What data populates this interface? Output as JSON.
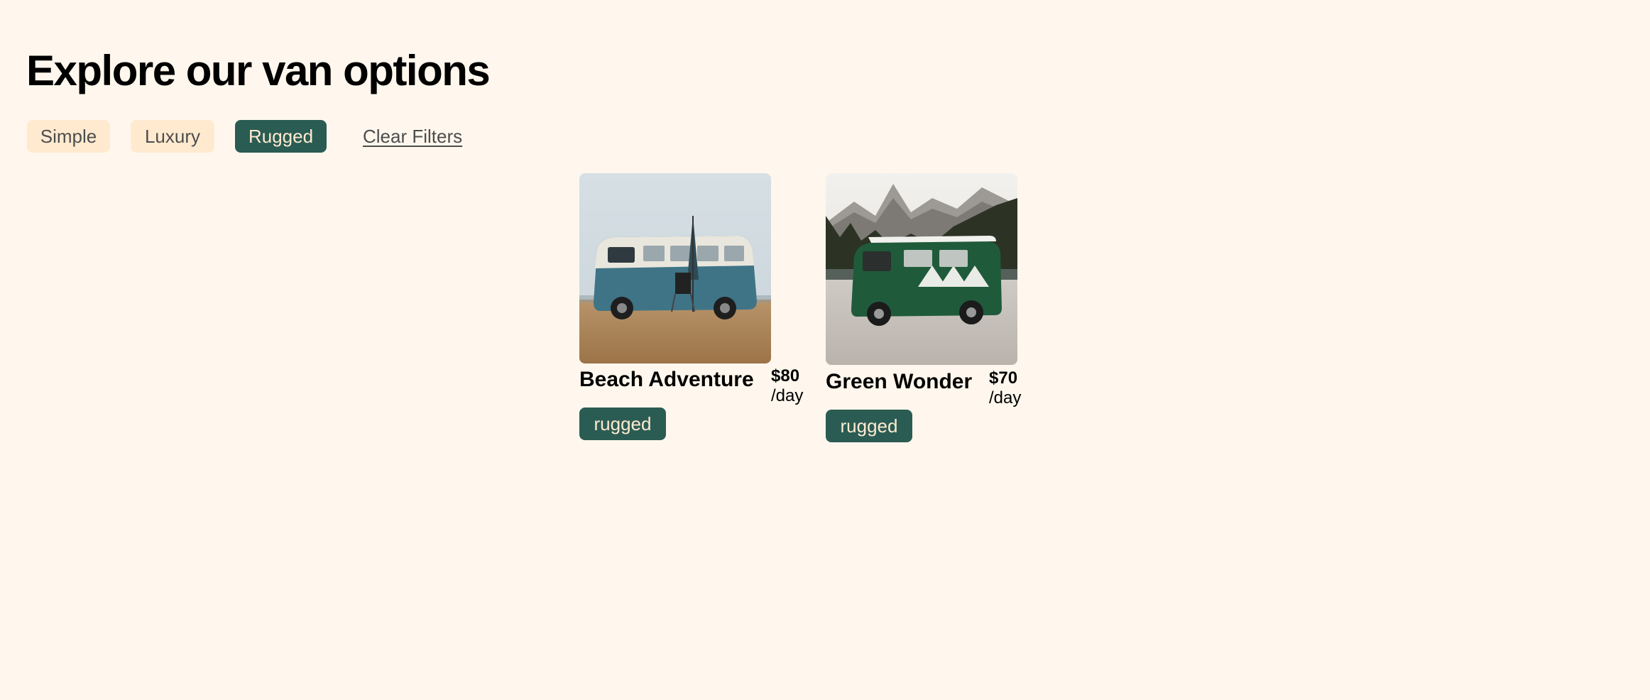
{
  "page": {
    "title": "Explore our van options"
  },
  "filters": {
    "options": [
      "Simple",
      "Luxury",
      "Rugged"
    ],
    "active": "Rugged",
    "clear_label": "Clear Filters"
  },
  "vans": [
    {
      "name": "Beach Adventure",
      "price": "$80",
      "price_unit": "/day",
      "type": "rugged",
      "image_icon": "blue-camper-van-beach-photo"
    },
    {
      "name": "Green Wonder",
      "price": "$70",
      "price_unit": "/day",
      "type": "rugged",
      "image_icon": "green-camper-van-mountains-photo"
    }
  ],
  "colors": {
    "background": "#fff7ed",
    "chip_inactive": "#ffead0",
    "chip_active": "#2a5c53",
    "badge_rugged": "#2a5c53",
    "badge_text": "#ffead0"
  }
}
